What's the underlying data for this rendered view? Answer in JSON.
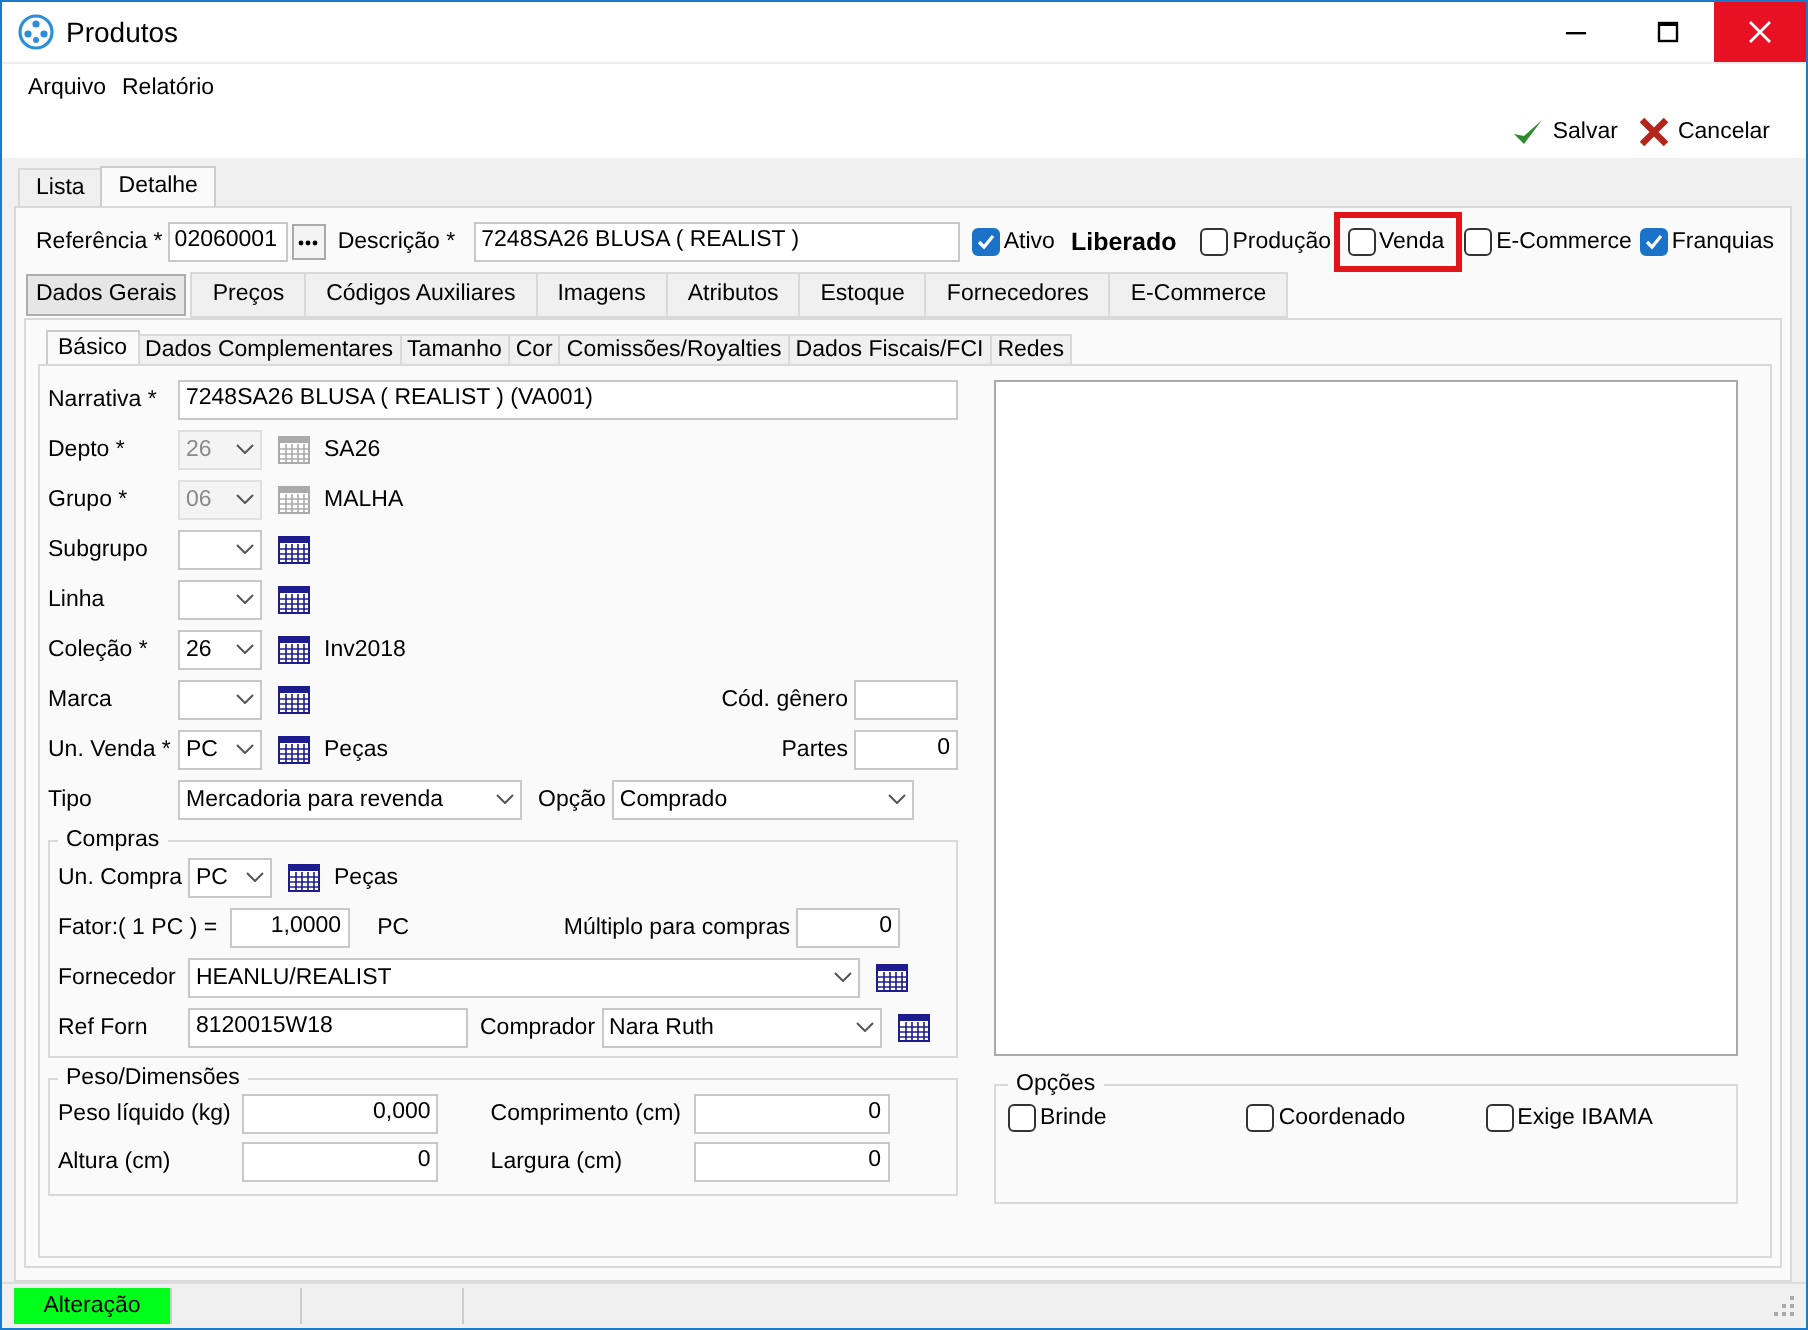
{
  "window": {
    "title": "Produtos"
  },
  "menu": [
    "Arquivo",
    "Relatório"
  ],
  "toolbar": [
    {
      "kind": "save",
      "label": "Salvar"
    },
    {
      "kind": "cancel",
      "label": "Cancelar"
    }
  ],
  "main_tabs": [
    {
      "label": "Lista",
      "selected": false
    },
    {
      "label": "Detalhe",
      "selected": true
    }
  ],
  "header": {
    "referencia": {
      "label": "Referência *",
      "value": "02060001"
    },
    "descricao": {
      "label": "Descrição *",
      "value": "7248SA26 BLUSA ( REALIST )"
    },
    "flags": [
      {
        "label": "Ativo",
        "checked": true,
        "note": "Liberado"
      },
      {
        "label": "Produção",
        "checked": false
      },
      {
        "label": "Venda",
        "checked": false,
        "highlighted": true
      },
      {
        "label": "E-Commerce",
        "checked": false
      },
      {
        "label": "Franquias",
        "checked": true
      }
    ]
  },
  "section_tabs": [
    {
      "label": "Dados Gerais",
      "selected": true
    },
    {
      "label": "Preços",
      "selected": false
    },
    {
      "label": "Códigos Auxiliares",
      "selected": false
    },
    {
      "label": "Imagens",
      "selected": false
    },
    {
      "label": "Atributos",
      "selected": false
    },
    {
      "label": "Estoque",
      "selected": false
    },
    {
      "label": "Fornecedores",
      "selected": false
    },
    {
      "label": "E-Commerce",
      "selected": false
    }
  ],
  "sub_tabs": [
    {
      "label": "Básico",
      "selected": true
    },
    {
      "label": "Dados Complementares",
      "selected": false
    },
    {
      "label": "Tamanho",
      "selected": false
    },
    {
      "label": "Cor",
      "selected": false
    },
    {
      "label": "Comissões/Royalties",
      "selected": false
    },
    {
      "label": "Dados Fiscais/FCI",
      "selected": false
    },
    {
      "label": "Redes",
      "selected": false
    }
  ],
  "rows": [
    {
      "kind": "text",
      "label": "Narrativa *",
      "value": "7248SA26 BLUSA ( REALIST ) (VA001)"
    },
    {
      "kind": "lookup",
      "label": "Depto *",
      "value": "26",
      "disabled": true,
      "description": "SA26"
    },
    {
      "kind": "lookup",
      "label": "Grupo *",
      "value": "06",
      "disabled": true,
      "description": "MALHA"
    },
    {
      "kind": "lookup",
      "label": "Subgrupo",
      "disabled": false
    },
    {
      "kind": "lookup",
      "label": "Linha",
      "disabled": false
    },
    {
      "kind": "lookup",
      "label": "Coleção *",
      "value": "26",
      "disabled": false,
      "description": "Inv2018"
    },
    {
      "kind": "lookup",
      "label": "Marca",
      "disabled": false,
      "extra": {
        "label": "Cód. gênero"
      }
    },
    {
      "kind": "lookup",
      "label": "Un. Venda *",
      "value": "PC",
      "disabled": false,
      "description": "Peças",
      "extra": {
        "label": "Partes",
        "value": "0"
      }
    },
    {
      "kind": "select",
      "label": "Tipo",
      "value": "Mercadoria para revenda",
      "extra": {
        "label": "Opção",
        "value": "Comprado"
      }
    }
  ],
  "compras": {
    "title": "Compras",
    "un_compra": {
      "label": "Un. Compra",
      "value": "PC",
      "description": "Peças"
    },
    "fator": {
      "label": "Fator:( 1 PC ) =",
      "value": "1,0000",
      "unit": "PC"
    },
    "multiplo": {
      "label": "Múltiplo para compras",
      "value": "0"
    },
    "fornecedor": {
      "label": "Fornecedor",
      "value": "HEANLU/REALIST"
    },
    "ref_forn": {
      "label": "Ref Forn",
      "value": "8120015W18"
    },
    "comprador": {
      "label": "Comprador",
      "value": "Nara Ruth"
    }
  },
  "peso": {
    "title": "Peso/Dimensões",
    "fields": [
      {
        "label": "Peso líquido (kg)",
        "value": "0,000"
      },
      {
        "label": "Comprimento (cm)",
        "value": "0"
      },
      {
        "label": "Altura (cm)",
        "value": "0"
      },
      {
        "label": "Largura (cm)",
        "value": "0"
      }
    ]
  },
  "opcoes": {
    "title": "Opções",
    "items": [
      {
        "label": "Brinde",
        "checked": false
      },
      {
        "label": "Coordenado",
        "checked": false
      },
      {
        "label": "Exige IBAMA",
        "checked": false
      }
    ]
  },
  "status_bar": {
    "mode": "Alteração"
  }
}
